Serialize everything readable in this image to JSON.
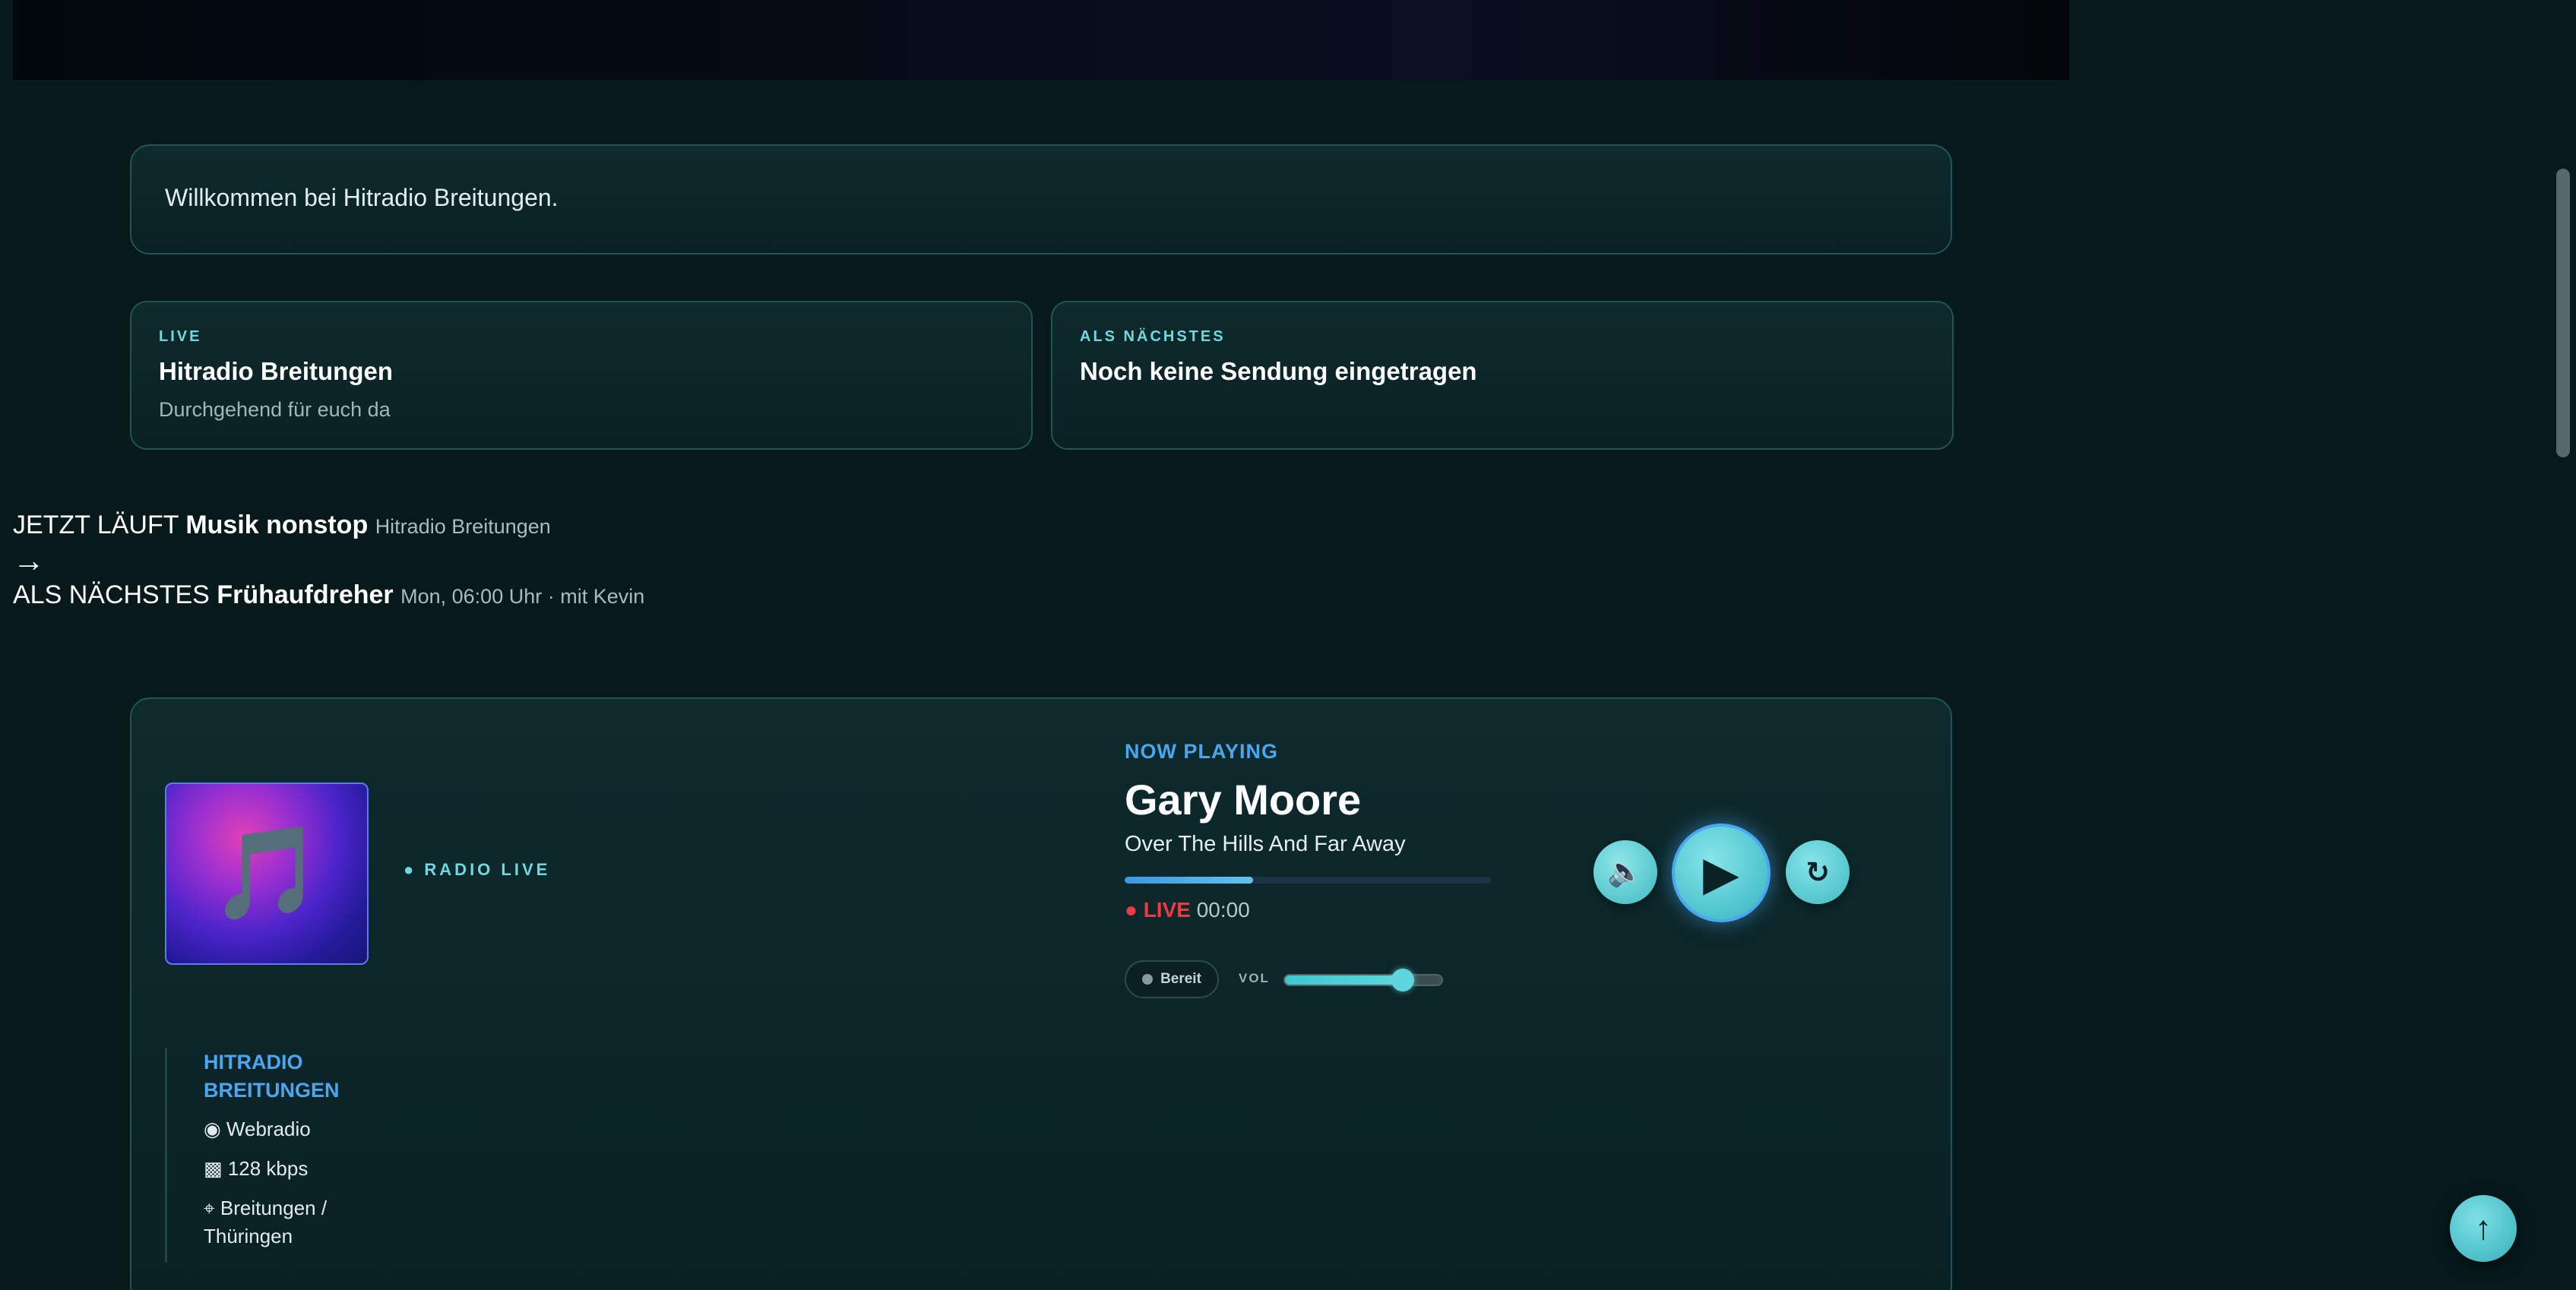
{
  "welcome": {
    "text": "Willkommen bei Hitradio Breitungen."
  },
  "cards": {
    "live": {
      "eyebrow": "LIVE",
      "title": "Hitradio Breitungen",
      "subtitle": "Durchgehend für euch da"
    },
    "next": {
      "eyebrow": "ALS NÄCHSTES",
      "title": "Noch keine Sendung eingetragen"
    }
  },
  "ticker": {
    "now_prefix": "JETZT LÄUFT",
    "now_show": "Musik nonstop",
    "now_meta": "Hitradio Breitungen",
    "arrow": "→",
    "next_prefix": "ALS NÄCHSTES",
    "next_show": "Frühaufdreher",
    "next_meta": "Mon, 06:00 Uhr · mit Kevin"
  },
  "player": {
    "cover_icon": "🎵",
    "cover_icon_name": "music-note-icon",
    "radio_live_label": "● RADIO LIVE",
    "now_playing_label": "NOW PLAYING",
    "artist": "Gary Moore",
    "track": "Over The Hills And Far Away",
    "progress": 0.35,
    "live_dot": "●",
    "live_word": "LIVE",
    "time": "00:00",
    "status": "Bereit",
    "vol_label": "VOL",
    "volume": 0.75,
    "mute_icon": "🔈",
    "play_icon": "▶",
    "refresh_icon": "↻"
  },
  "station": {
    "name": "HITRADIO BREITUNGEN",
    "type_icon": "◉",
    "type": "Webradio",
    "bitrate_icon": "▩",
    "bitrate": "128 kbps",
    "location_icon": "⌖",
    "location": "Breitungen / Thüringen"
  },
  "scroll_top_icon": "↑",
  "colors": {
    "accent": "#5fd6dd",
    "blue": "#4ba6f0",
    "live_red": "#ef3a44",
    "background": "#07191b"
  }
}
